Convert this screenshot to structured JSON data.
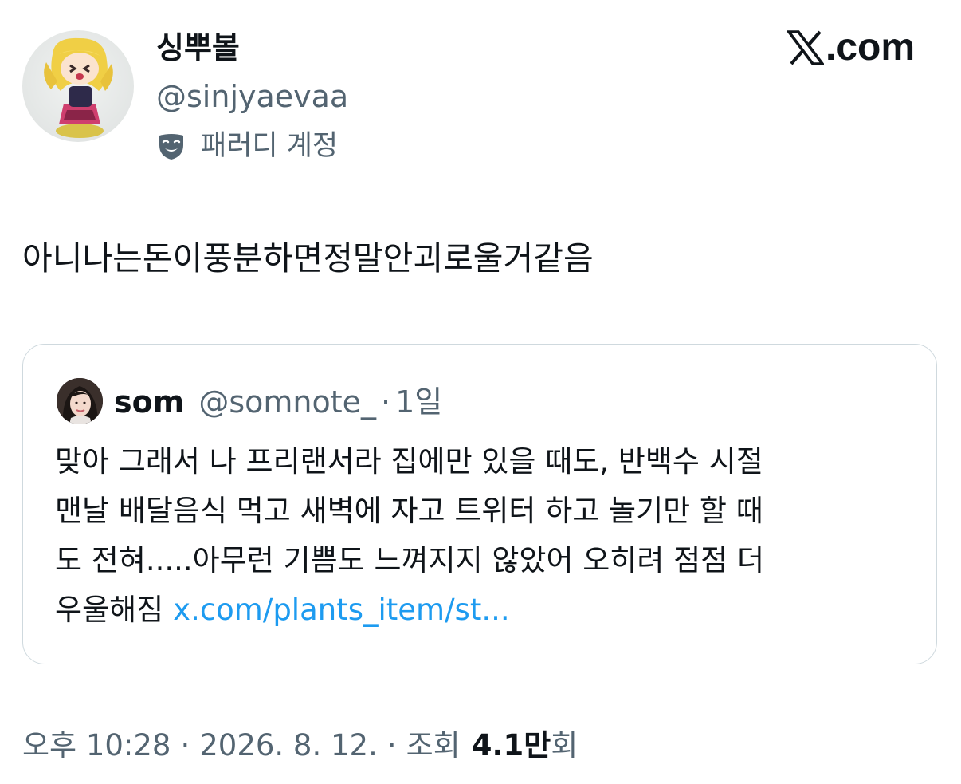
{
  "author": {
    "display_name": "싱뿌볼",
    "handle": "@sinjyaevaa",
    "parody_label": "패러디 계정"
  },
  "brand": {
    "suffix": ".com",
    "icon": "x-logo-icon"
  },
  "tweet": {
    "text": "아니나는돈이풍분하면정말안괴로울거같음"
  },
  "quote": {
    "name": "som",
    "handle": "@somnote_",
    "separator": "·",
    "time": "1일",
    "lines": [
      "맞아 그래서 나 프리랜서라 집에만 있을 때도, 반백수 시절",
      "맨날 배달음식 먹고 새벽에 자고 트위터 하고 놀기만 할 때",
      "도 전혀.....아무런 기쁨도 느껴지지 않았어 오히려 점점 더",
      "우울해짐"
    ],
    "link": "x.com/plants_item/st..."
  },
  "meta": {
    "time": "오후 10:28",
    "separator": "·",
    "date": "2026. 8. 12.",
    "views_label": "조회",
    "views_count": "4.1만",
    "views_unit": "회"
  },
  "colors": {
    "text": "#0f1419",
    "secondary": "#536471",
    "link": "#1d9bf0",
    "border": "#cfd9de"
  }
}
